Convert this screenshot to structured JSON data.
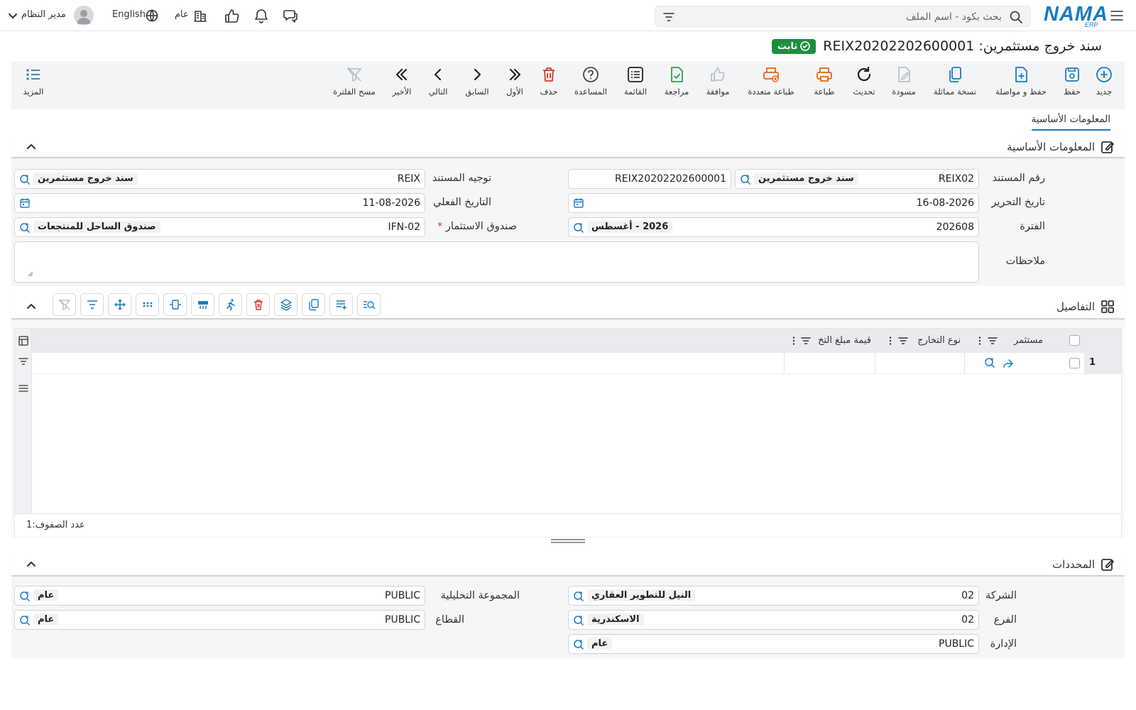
{
  "topbar": {
    "search_placeholder": "بحث بكود - اسم الملف",
    "logo_text": "NAMA",
    "logo_sub": "ERP",
    "language": "English",
    "company_label": "عام",
    "user_name": "مدير النظام"
  },
  "page": {
    "title": "سند خروج مستثمرين: REIX20202202600001",
    "status_badge": "ثابت"
  },
  "toolbar": {
    "items": [
      {
        "label": "جديد",
        "icon": "plus-circle-icon"
      },
      {
        "label": "حفظ",
        "icon": "save-icon"
      },
      {
        "label": "حفظ و مواصلة",
        "icon": "save-continue-icon"
      },
      {
        "label": "نسخة مماثلة",
        "icon": "copy-icon"
      },
      {
        "label": "مسودة",
        "icon": "draft-icon"
      },
      {
        "label": "تحديث",
        "icon": "refresh-icon"
      },
      {
        "label": "طباعة",
        "icon": "print-icon"
      },
      {
        "label": "طباعة متعددة",
        "icon": "multi-print-icon"
      },
      {
        "label": "موافقة",
        "icon": "thumbs-up-icon"
      },
      {
        "label": "مراجعة",
        "icon": "review-icon"
      },
      {
        "label": "القائمة",
        "icon": "list-icon"
      },
      {
        "label": "المساعدة",
        "icon": "help-icon"
      },
      {
        "label": "حذف",
        "icon": "trash-icon"
      },
      {
        "label": "الأول",
        "icon": "first-icon"
      },
      {
        "label": "السابق",
        "icon": "prev-icon"
      },
      {
        "label": "التالي",
        "icon": "next-icon"
      },
      {
        "label": "الأخير",
        "icon": "last-icon"
      },
      {
        "label": "مسح الفلترة",
        "icon": "clear-filter-icon"
      }
    ],
    "more_label": "المزيد"
  },
  "tabs": {
    "basic_info": "المعلومات الأساسية"
  },
  "basic_section": {
    "title": "المعلومات الأساسية",
    "doc_number": {
      "label": "رقم المستند",
      "code": "REIX02",
      "desc": "سند خروج مستثمرين",
      "number": "REIX20202202600001"
    },
    "doc_direction": {
      "label": "توجيه المستند",
      "code": "REIX",
      "desc": "سند خروج مستثمرين"
    },
    "issue_date": {
      "label": "تاريخ التحرير",
      "value": "16-08-2026"
    },
    "actual_date": {
      "label": "التاريخ الفعلي",
      "value": "11-08-2026"
    },
    "period": {
      "label": "الفترة",
      "code": "202608",
      "desc": "2026 - أغسطس"
    },
    "fund": {
      "label": "صندوق الاستثمار",
      "required_mark": "*",
      "code": "IFN-02",
      "desc": "صندوق الساحل للمنتجعات"
    },
    "notes": {
      "label": "ملاحظات",
      "value": ""
    }
  },
  "details_section": {
    "title": "التفاصيل",
    "columns": [
      "مستثمر",
      "نوع التخارج",
      "قيمة مبلغ التخ"
    ],
    "rows": [
      {
        "index": "1"
      }
    ],
    "footer_label": "عدد الصفوف:",
    "row_count": "1"
  },
  "dimensions_section": {
    "title": "المحددات",
    "company": {
      "label": "الشركة",
      "code": "02",
      "desc": "النيل للتطوير العقاري"
    },
    "branch": {
      "label": "الفرع",
      "code": "02",
      "desc": "الاسكندرية"
    },
    "department": {
      "label": "الإدارة",
      "code": "PUBLIC",
      "desc": "عام"
    },
    "analysis_group": {
      "label": "المجموعة التحليلية",
      "code": "PUBLIC",
      "desc": "عام"
    },
    "sector": {
      "label": "القطاع",
      "code": "PUBLIC",
      "desc": "عام"
    }
  },
  "colors": {
    "accent": "#1a7bc3",
    "badge": "#1e8e3e",
    "danger": "#d9342b",
    "print": "#e8660c",
    "review": "#2e9e4a"
  }
}
